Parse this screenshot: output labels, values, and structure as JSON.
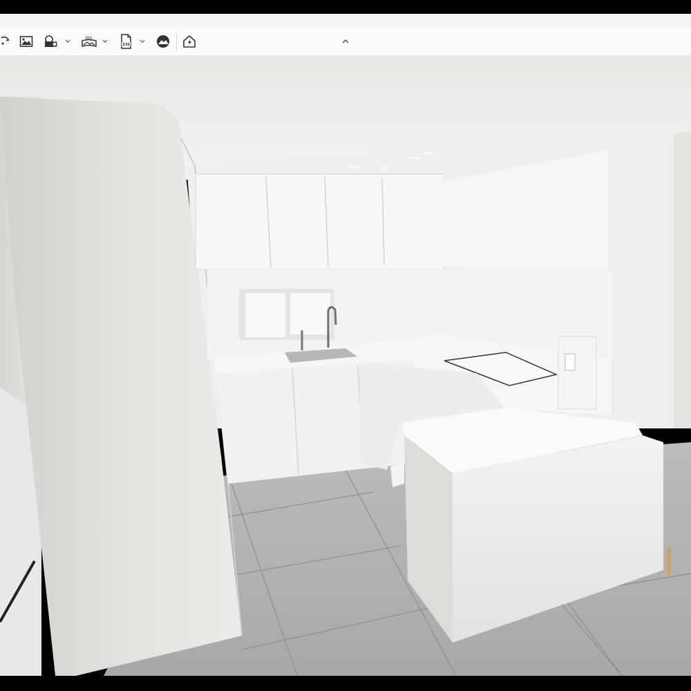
{
  "toolbar": {
    "items": [
      {
        "icon": "render-ai-icon"
      },
      {
        "icon": "image-icon"
      },
      {
        "icon": "video-render-icon"
      },
      {
        "icon": "panorama-360-icon"
      },
      {
        "icon": "export-exe-icon"
      },
      {
        "icon": "cloud-share-icon"
      },
      {
        "icon": "live-sync-icon"
      }
    ],
    "collapse_icon": "chevron-up-icon"
  },
  "viewport": {
    "scene": "kitchen-3d-render"
  }
}
